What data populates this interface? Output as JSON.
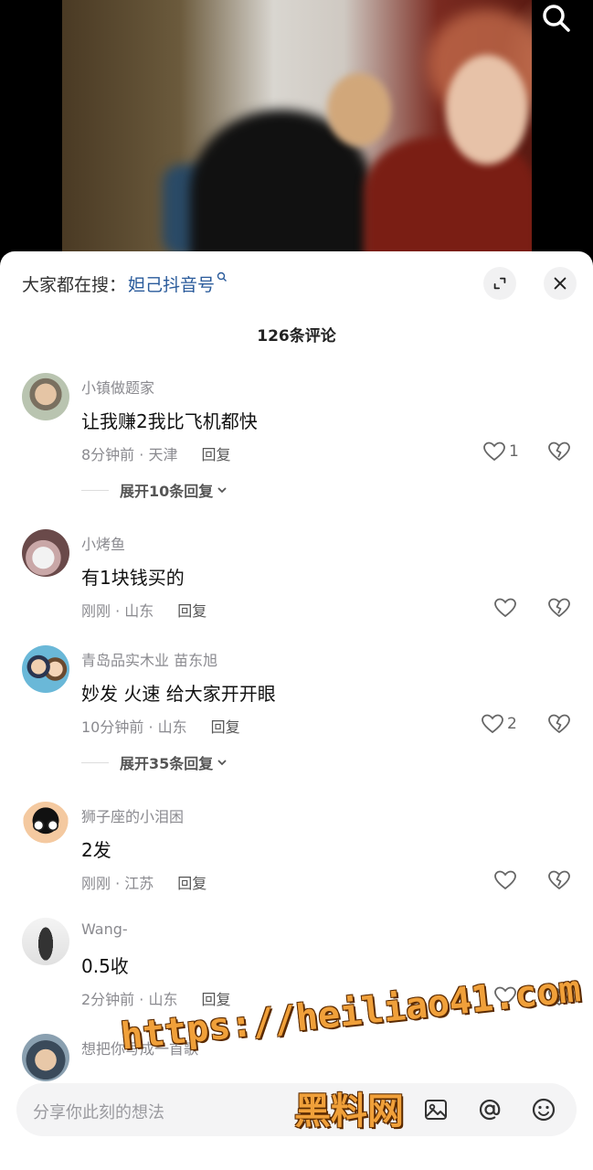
{
  "video": {
    "search_icon": "search-icon"
  },
  "header": {
    "search_prefix": "大家都在搜：",
    "search_keyword": "妲己抖音号",
    "expand_icon": "expand-icon",
    "close_icon": "close-icon"
  },
  "comment_count": "126条评论",
  "comments": [
    {
      "username": "小镇做题家",
      "text": "让我赚2我比飞机都快",
      "time_loc": "8分钟前 · 天津",
      "reply": "回复",
      "likes": "1",
      "expand": "展开10条回复"
    },
    {
      "username": "小烤鱼",
      "text": "有1块钱买的",
      "time_loc": "刚刚 · 山东",
      "reply": "回复",
      "likes": ""
    },
    {
      "username": "青岛品实木业 苗东旭",
      "text": "妙发 火速 给大家开开眼",
      "time_loc": "10分钟前 · 山东",
      "reply": "回复",
      "likes": "2",
      "expand": "展开35条回复"
    },
    {
      "username": "狮子座的小泪困",
      "text": "2发",
      "time_loc": "刚刚 · 江苏",
      "reply": "回复",
      "likes": ""
    },
    {
      "username": "Wang-",
      "text": "0.5收",
      "time_loc": "2分钟前 · 山东",
      "reply": "回复",
      "likes": ""
    },
    {
      "username": "想把你写成一首歌",
      "text": ""
    }
  ],
  "input": {
    "placeholder": "分享你此刻的想法"
  },
  "watermark": {
    "url": "https://heiliao41.com",
    "name": "黑料网"
  }
}
